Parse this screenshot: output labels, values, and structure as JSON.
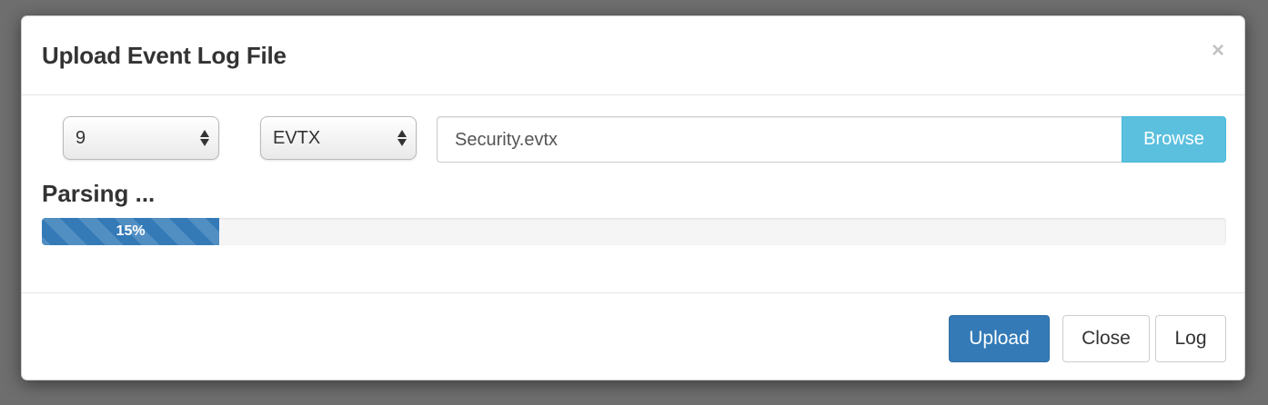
{
  "modal": {
    "title": "Upload Event Log File",
    "close_glyph": "×"
  },
  "form": {
    "count_select": {
      "value": "9"
    },
    "format_select": {
      "value": "EVTX"
    },
    "file_input": {
      "value": "Security.evtx"
    },
    "browse_label": "Browse"
  },
  "status": {
    "text": "Parsing ...",
    "progress_percent": 15,
    "progress_label": "15%"
  },
  "footer": {
    "upload_label": "Upload",
    "close_label": "Close",
    "log_label": "Log"
  },
  "colors": {
    "primary": "#337ab7",
    "info": "#5bc0de",
    "text": "#333333"
  },
  "icons": {
    "close": "close-icon",
    "select_arrows": "select-arrows-icon"
  }
}
